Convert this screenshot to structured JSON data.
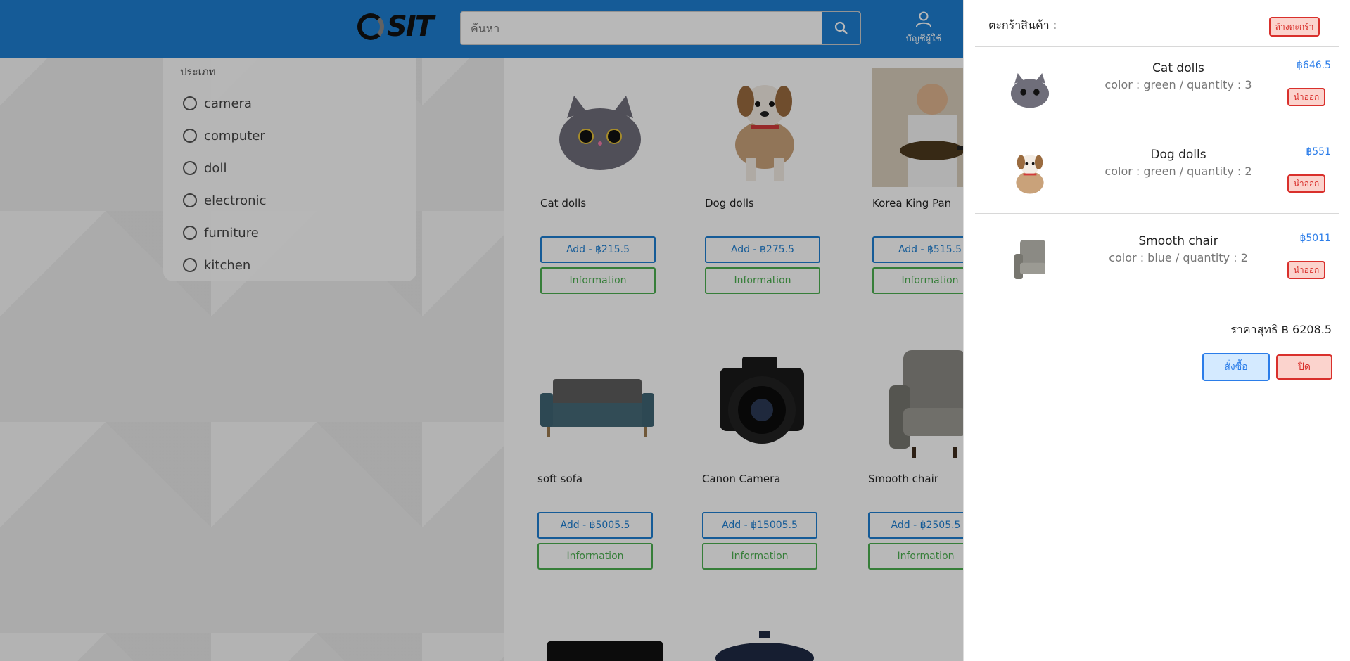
{
  "header": {
    "logo_text": "SIT",
    "search_placeholder": "ค้นหา",
    "account_label": "บัญชีผู้ใช้"
  },
  "filter": {
    "title": "ประเภท",
    "options": [
      "camera",
      "computer",
      "doll",
      "electronic",
      "furniture",
      "kitchen"
    ]
  },
  "products": [
    {
      "name": "Cat dolls",
      "add_label": "Add - ฿215.5",
      "info_label": "Information",
      "icon": "cat-doll-icon"
    },
    {
      "name": "Dog dolls",
      "add_label": "Add - ฿275.5",
      "info_label": "Information",
      "icon": "dog-doll-icon"
    },
    {
      "name": "Korea King Pan",
      "add_label": "Add - ฿515.5",
      "info_label": "Information",
      "icon": "pan-icon"
    },
    {
      "name": "soft sofa",
      "add_label": "Add - ฿5005.5",
      "info_label": "Information",
      "icon": "sofa-icon"
    },
    {
      "name": "Canon Camera",
      "add_label": "Add - ฿15005.5",
      "info_label": "Information",
      "icon": "camera-icon"
    },
    {
      "name": "Smooth chair",
      "add_label": "Add - ฿2505.5",
      "info_label": "Information",
      "icon": "chair-icon"
    }
  ],
  "cart": {
    "title": "ตะกร้าสินค้า :",
    "clear_label": "ล้างตะกร้า",
    "items": [
      {
        "name": "Cat dolls",
        "detail": "color : green / quantity : 3",
        "price": "฿646.5",
        "remove_label": "นำออก",
        "icon": "cat-doll-icon"
      },
      {
        "name": "Dog dolls",
        "detail": "color : green / quantity : 2",
        "price": "฿551",
        "remove_label": "นำออก",
        "icon": "dog-doll-icon"
      },
      {
        "name": "Smooth chair",
        "detail": "color : blue / quantity : 2",
        "price": "฿5011",
        "remove_label": "นำออก",
        "icon": "chair-icon"
      }
    ],
    "total_label": "ราคาสุทธิ ฿ 6208.5",
    "order_label": "สั่งซื้อ",
    "close_label": "ปิด"
  },
  "colors": {
    "primary": "#1e7fd2",
    "info": "#4caf50",
    "danger": "#d9302c",
    "price": "#2b7de9"
  }
}
